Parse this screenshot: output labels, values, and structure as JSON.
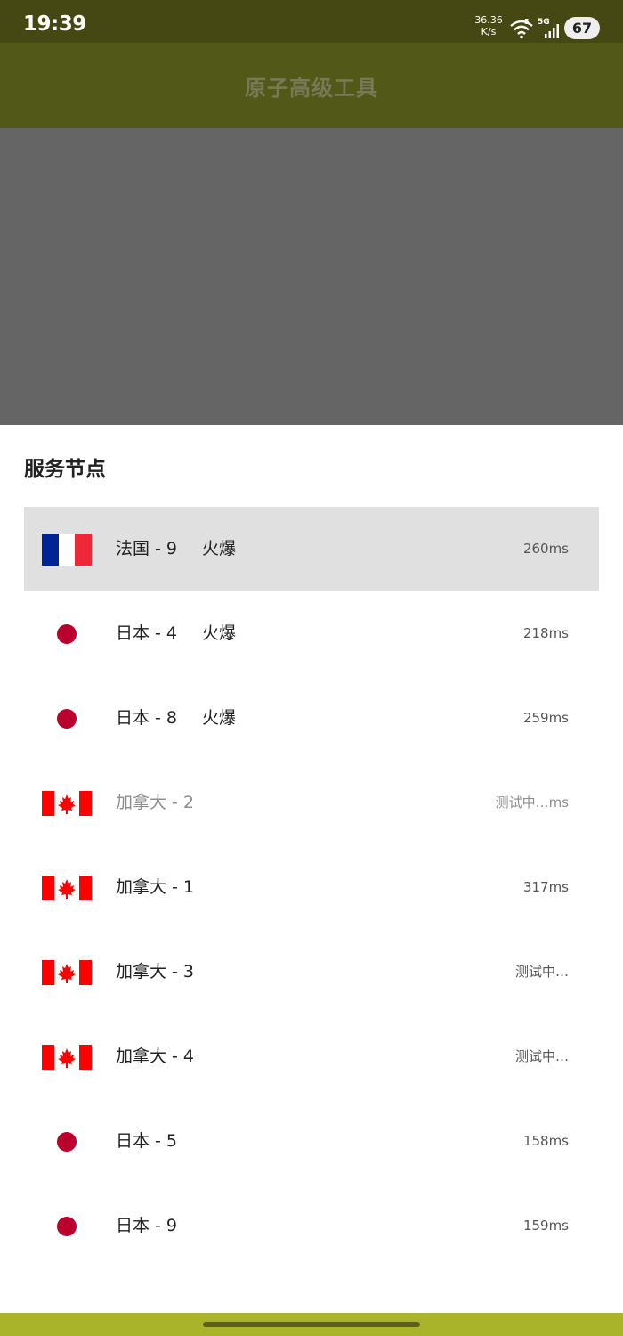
{
  "status_bar": {
    "time": "19:39",
    "net_speed_value": "36.36",
    "net_speed_unit": "K/s",
    "wifi_badge": "5",
    "network_label": "5G",
    "battery": "67"
  },
  "app_bar": {
    "title": "原子高级工具"
  },
  "sheet": {
    "title": "服务节点",
    "nodes": [
      {
        "flag": "france-flag",
        "label": "法国 - 9",
        "tag": "火爆",
        "latency": "260ms",
        "selected": true
      },
      {
        "flag": "japan-flag",
        "label": "日本 - 4",
        "tag": "火爆",
        "latency": "218ms"
      },
      {
        "flag": "japan-flag",
        "label": "日本 - 8",
        "tag": "火爆",
        "latency": "259ms"
      },
      {
        "flag": "canada-flag",
        "label": "加拿大 - 2",
        "tag": "",
        "latency": "测试中…ms",
        "dimmed": true
      },
      {
        "flag": "canada-flag",
        "label": "加拿大 - 1",
        "tag": "",
        "latency": "317ms"
      },
      {
        "flag": "canada-flag",
        "label": "加拿大 - 3",
        "tag": "",
        "latency": "测试中…"
      },
      {
        "flag": "canada-flag",
        "label": "加拿大 - 4",
        "tag": "",
        "latency": "测试中…"
      },
      {
        "flag": "japan-flag",
        "label": "日本 - 5",
        "tag": "",
        "latency": "158ms"
      },
      {
        "flag": "japan-flag",
        "label": "日本 - 9",
        "tag": "",
        "latency": "159ms"
      }
    ]
  },
  "colors": {
    "status_bar": "#464813",
    "app_bar": "#525818",
    "overlay": "#656565",
    "nav_bar": "#a9b42a",
    "selected_row": "#e0e0e0"
  }
}
